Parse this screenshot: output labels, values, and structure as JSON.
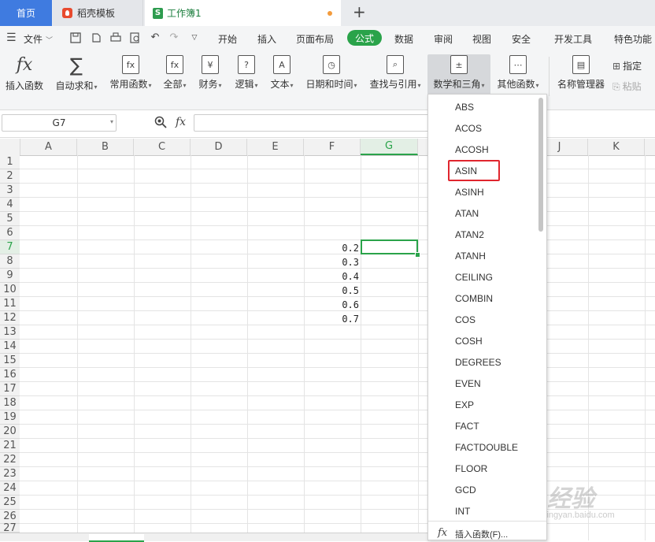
{
  "tabs": {
    "home": "首页",
    "templates": "稻壳模板",
    "workbook": "工作簿1",
    "workbook_icon": "S",
    "add": "+"
  },
  "menubar": {
    "file": "文件",
    "items": [
      "开始",
      "插入",
      "页面布局",
      "公式",
      "数据",
      "审阅",
      "视图",
      "安全",
      "开发工具",
      "特色功能"
    ]
  },
  "ribbon": {
    "insert_function": "插入函数",
    "autosum": "自动求和",
    "common": "常用函数",
    "all": "全部",
    "finance": "财务",
    "logic": "逻辑",
    "text": "文本",
    "datetime": "日期和时间",
    "lookup": "查找与引用",
    "math": "数学和三角",
    "other": "其他函数",
    "name_manager": "名称管理器",
    "specify": "指定",
    "paste": "粘贴"
  },
  "formula_bar": {
    "name_box": "G7",
    "fx": "fx",
    "value": ""
  },
  "grid": {
    "columns": [
      "A",
      "B",
      "C",
      "D",
      "E",
      "F",
      "G",
      "H",
      "I",
      "J",
      "K"
    ],
    "rows": [
      "1",
      "2",
      "3",
      "4",
      "5",
      "6",
      "7",
      "8",
      "9",
      "10",
      "11",
      "12",
      "13",
      "14",
      "15",
      "16",
      "17",
      "18",
      "19",
      "20",
      "21",
      "22",
      "23",
      "24",
      "25",
      "26",
      "27"
    ],
    "selected_cell": "G7",
    "f_values": [
      "0.2",
      "0.3",
      "0.4",
      "0.5",
      "0.6",
      "0.7"
    ]
  },
  "function_menu": {
    "items": [
      "ABS",
      "ACOS",
      "ACOSH",
      "ASIN",
      "ASINH",
      "ATAN",
      "ATAN2",
      "ATANH",
      "CEILING",
      "COMBIN",
      "COS",
      "COSH",
      "DEGREES",
      "EVEN",
      "EXP",
      "FACT",
      "FACTDOUBLE",
      "FLOOR",
      "GCD",
      "INT"
    ],
    "highlighted": "ASIN",
    "insert_function": "插入函数(F)..."
  },
  "watermark": {
    "main": "Bai 经验",
    "sub": "jingyan.baidu.com"
  },
  "colors": {
    "accent_green": "#2aa34a",
    "home_tab_blue": "#3f7be0",
    "highlight_red": "#e0262e"
  }
}
